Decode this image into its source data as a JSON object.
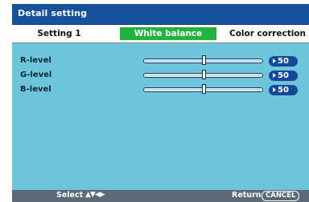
{
  "dialog": {
    "title": "Detail setting"
  },
  "tabs": [
    {
      "label": "Setting 1",
      "active": false
    },
    {
      "label": "White balance",
      "active": true
    },
    {
      "label": "Color correction",
      "active": false
    }
  ],
  "levels": [
    {
      "label": "R-level",
      "value": "50",
      "fraction": 0.5
    },
    {
      "label": "G-level",
      "value": "50",
      "fraction": 0.5
    },
    {
      "label": "B-level",
      "value": "50",
      "fraction": 0.5
    }
  ],
  "footer": {
    "select_label": "Select",
    "arrows": "▲▼◀▶",
    "return_label": "Return",
    "cancel_label": "CANCEL"
  },
  "colors": {
    "title_bar": "#16529c",
    "active_tab": "#22b23f",
    "panel": "#6ec4d8",
    "value_pill": "#14499a",
    "footer": "#5c6a78"
  }
}
